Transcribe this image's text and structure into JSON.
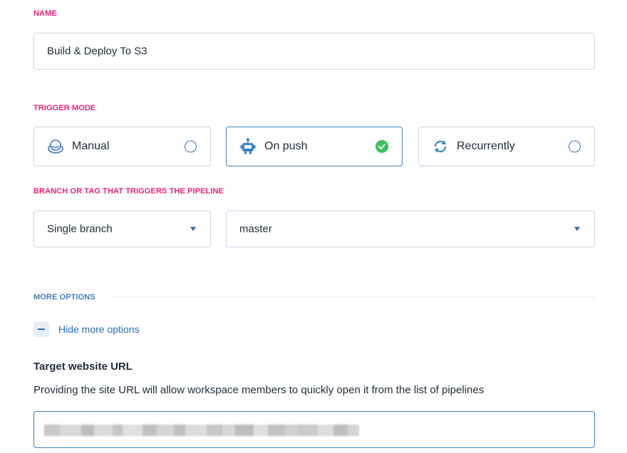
{
  "name_section": {
    "label": "NAME",
    "value": "Build & Deploy To S3"
  },
  "trigger_section": {
    "label": "TRIGGER MODE",
    "modes": [
      {
        "label": "Manual",
        "icon": "manual-icon",
        "selected": false
      },
      {
        "label": "On push",
        "icon": "robot-icon",
        "selected": true
      },
      {
        "label": "Recurrently",
        "icon": "recurring-icon",
        "selected": false
      }
    ]
  },
  "branch_section": {
    "label": "BRANCH OR TAG THAT TRIGGERS THE PIPELINE",
    "branch_type": "Single branch",
    "branch_name": "master"
  },
  "more_options": {
    "label": "MORE OPTIONS",
    "toggle_label": "Hide more options"
  },
  "target_url": {
    "heading": "Target website URL",
    "description": "Providing the site URL will allow workspace members to quickly open it from the list of pipelines",
    "value_obscured": true
  },
  "colors": {
    "section_label": "#e0247a",
    "more_options_label": "#4a7bb8",
    "accent": "#3b82c6",
    "link": "#2a6cc0",
    "check": "#3ec15b",
    "border": "#c9d8e8"
  }
}
